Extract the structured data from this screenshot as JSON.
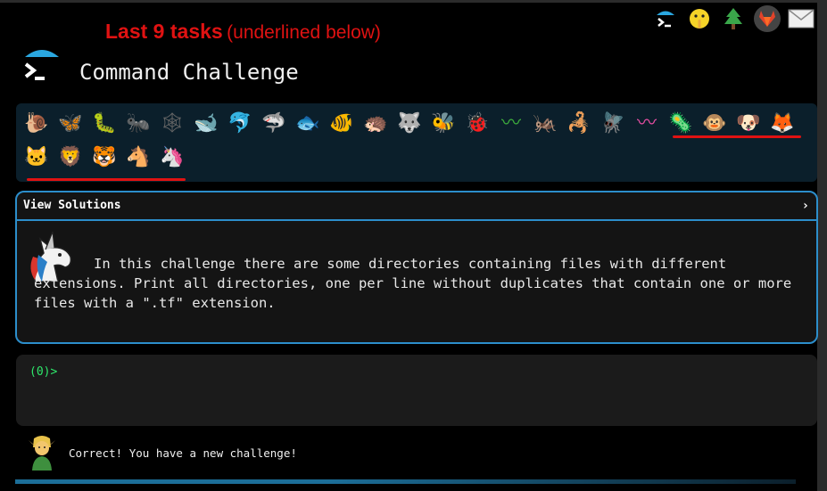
{
  "banner": {
    "main": "Last 9 tasks",
    "sub": "(underlined below)"
  },
  "header": {
    "title": "Command Challenge"
  },
  "top_icons": [
    {
      "name": "terminal-logo-icon",
      "glyph": ">_"
    },
    {
      "name": "shushing-face-icon",
      "glyph": "🤫"
    },
    {
      "name": "pine-tree-icon",
      "glyph": "🌲"
    },
    {
      "name": "gitlab-icon",
      "glyph": "🦊"
    },
    {
      "name": "mail-icon",
      "glyph": "✉"
    }
  ],
  "animals": [
    {
      "name": "snail-icon",
      "glyph": "🐌",
      "color": "#8a6d45"
    },
    {
      "name": "butterfly-icon",
      "glyph": "🦋",
      "color": "#e38a2a"
    },
    {
      "name": "caterpillar-icon",
      "glyph": "🐛",
      "color": "#4c9a2e"
    },
    {
      "name": "ant-icon",
      "glyph": "🐜",
      "color": "#333"
    },
    {
      "name": "spider-web-icon",
      "glyph": "🕸",
      "color": "#666"
    },
    {
      "name": "whale-icon",
      "glyph": "🐋",
      "color": "#2f8fc9"
    },
    {
      "name": "dolphin-icon",
      "glyph": "🐬",
      "color": "#2f8fc9"
    },
    {
      "name": "shark-icon",
      "glyph": "🦈",
      "color": "#7aa3b8"
    },
    {
      "name": "fish-icon",
      "glyph": "🐟",
      "color": "#3aa0d8"
    },
    {
      "name": "tropical-fish-icon",
      "glyph": "🐠",
      "color": "#e0b020"
    },
    {
      "name": "hedgehog-icon",
      "glyph": "🦔",
      "color": "#6b4b2e"
    },
    {
      "name": "wolf-icon",
      "glyph": "🐺",
      "color": "#7d7d7d"
    },
    {
      "name": "bee-icon",
      "glyph": "🐝",
      "color": "#e0c020"
    },
    {
      "name": "lady-beetle-icon",
      "glyph": "🐞",
      "color": "#d02020"
    },
    {
      "name": "worm-icon",
      "glyph": "〰",
      "color": "#3cab3c"
    },
    {
      "name": "cricket-icon",
      "glyph": "🦗",
      "color": "#333"
    },
    {
      "name": "scorpion-icon",
      "glyph": "🦂",
      "color": "#c03030"
    },
    {
      "name": "fly-icon",
      "glyph": "🪰",
      "color": "#888"
    },
    {
      "name": "pink-worm-icon",
      "glyph": "〰",
      "color": "#e34da0"
    },
    {
      "name": "microbe-icon",
      "glyph": "🦠",
      "color": "#3a8fd8"
    },
    {
      "name": "monkey-icon",
      "glyph": "🐵",
      "color": "#7a5230"
    },
    {
      "name": "dog-icon",
      "glyph": "🐶",
      "color": "#d08a30"
    },
    {
      "name": "fox-icon",
      "glyph": "🦊",
      "color": "#e0662a"
    },
    {
      "name": "cat-icon",
      "glyph": "🐱",
      "color": "#d9a14a"
    },
    {
      "name": "lion-icon",
      "glyph": "🦁",
      "color": "#d9a14a"
    },
    {
      "name": "tiger-icon",
      "glyph": "🐯",
      "color": "#e08a2a"
    },
    {
      "name": "horse-icon",
      "glyph": "🐴",
      "color": "#7a4a2a"
    },
    {
      "name": "unicorn-icon",
      "glyph": "🦄",
      "color": "#fff"
    }
  ],
  "solutions": {
    "header": "View Solutions",
    "chevron": "›",
    "description": "In this challenge there are some directories containing files with different extensions. Print all directories, one per line without duplicates that contain one or more files with a \".tf\" extension."
  },
  "terminal": {
    "prompt": "(0)>"
  },
  "status": {
    "message": "Correct! You have a new challenge!"
  }
}
